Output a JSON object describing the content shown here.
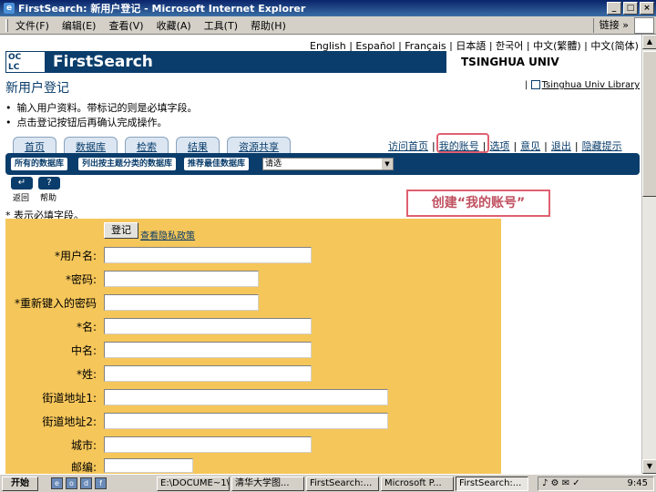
{
  "window": {
    "title": "FirstSearch: 新用户登记 - Microsoft Internet Explorer"
  },
  "menu": [
    "文件(F)",
    "编辑(E)",
    "查看(V)",
    "收藏(A)",
    "工具(T)",
    "帮助(H)"
  ],
  "links_label": "链接 »",
  "languages": "English | Español | Français | 日本語 | 한국어 | 中文(繁體) | 中文(简体)",
  "header": {
    "oclc": "OC\nLC",
    "brand": "FirstSearch",
    "institution": "TSINGHUA UNIV"
  },
  "page_title": "新用户登记",
  "univ_library_link": "Tsinghua Univ Library",
  "instructions": [
    "输入用户资料。带标记的则是必填字段。",
    "点击登记按钮后再确认完成操作。"
  ],
  "tabs": [
    "首页",
    "数据库",
    "检索",
    "结果",
    "资源共享"
  ],
  "top_links": [
    "访问首页",
    "我的账号",
    "选项",
    "意见",
    "退出",
    "隐藏提示"
  ],
  "sub_tabs": [
    "所有的数据库",
    "列出按主题分类的数据库",
    "推荐最佳数据库"
  ],
  "sub_select": "请选",
  "icons": {
    "back_label": "返回",
    "help_label": "帮助"
  },
  "required_note": "* 表示必填字段。",
  "callout": "创建“我的账号”",
  "form": {
    "register_button": "登记",
    "privacy_link": "查看隐私政策",
    "fields": [
      {
        "label": "*用户名:"
      },
      {
        "label": "*密码:"
      },
      {
        "label": "*重新键入的密码"
      },
      {
        "label": "*名:"
      },
      {
        "label": "中名:"
      },
      {
        "label": "*姓:"
      },
      {
        "label": "街道地址1:"
      },
      {
        "label": "街道地址2:"
      },
      {
        "label": "城市:"
      },
      {
        "label": "邮编:"
      }
    ]
  },
  "taskbar": {
    "start": "开始",
    "tasks": [
      "E:\\DOCUME~1\\...",
      "清华大学图...",
      "FirstSearch:...",
      "Microsoft P...",
      "FirstSearch:..."
    ],
    "clock": "9:45"
  },
  "colors": {
    "brand_blue": "#0a3d6b",
    "form_bg": "#f5c65a",
    "highlight": "#e06070"
  }
}
